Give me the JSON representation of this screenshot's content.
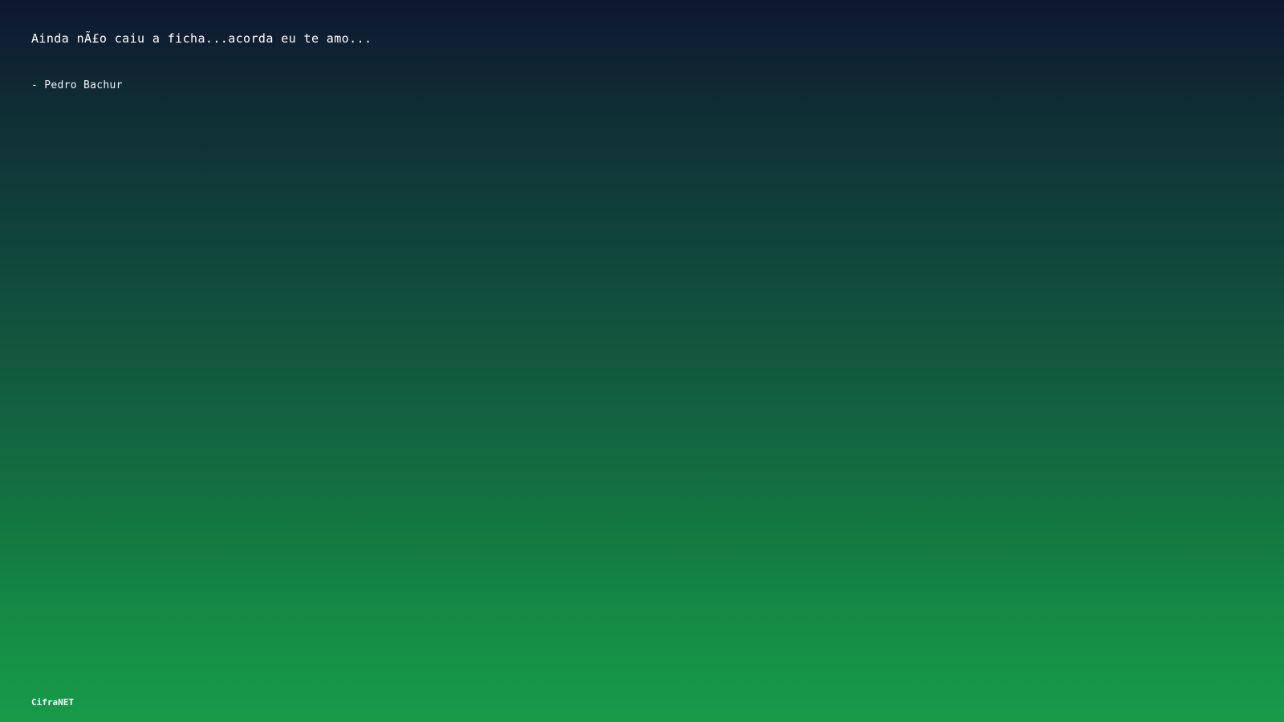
{
  "quote": {
    "text": "Ainda nÃ£o caiu a ficha...acorda eu te amo...",
    "author": "- Pedro Bachur"
  },
  "brand": {
    "label": "CifraNET"
  },
  "colors": {
    "gradient_top": "#0e1730",
    "gradient_bottom": "#169b48",
    "text": "#ffffff"
  }
}
